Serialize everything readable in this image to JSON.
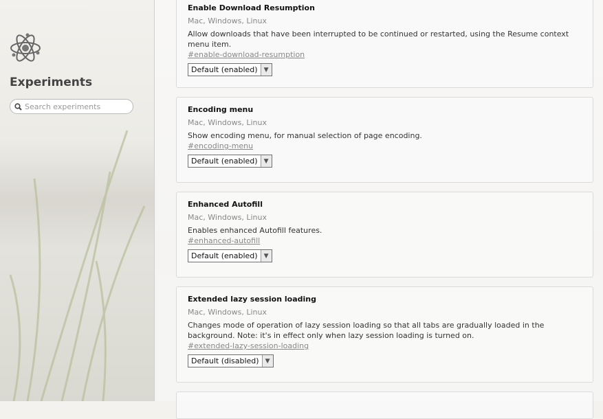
{
  "sidebar": {
    "title": "Experiments",
    "search_placeholder": "Search experiments"
  },
  "experiments": [
    {
      "name": "Enable Download Resumption",
      "platforms": "Mac, Windows, Linux",
      "description": "Allow downloads that have been interrupted to be continued or restarted, using the Resume context menu item.",
      "link": "#enable-download-resumption",
      "value": "Default (enabled)"
    },
    {
      "name": "Encoding menu",
      "platforms": "Mac, Windows, Linux",
      "description": "Show encoding menu, for manual selection of page encoding.",
      "link": "#encoding-menu",
      "value": "Default (enabled)"
    },
    {
      "name": "Enhanced Autofill",
      "platforms": "Mac, Windows, Linux",
      "description": "Enables enhanced Autofill features.",
      "link": "#enhanced-autofill",
      "value": "Default (enabled)"
    },
    {
      "name": "Extended lazy session loading",
      "platforms": "Mac, Windows, Linux",
      "description": "Changes mode of operation of lazy session loading so that all tabs are gradually loaded in the background. Note: it's in effect only when lazy session loading is turned on.",
      "link": "#extended-lazy-session-loading",
      "value": "Default (disabled)"
    }
  ]
}
